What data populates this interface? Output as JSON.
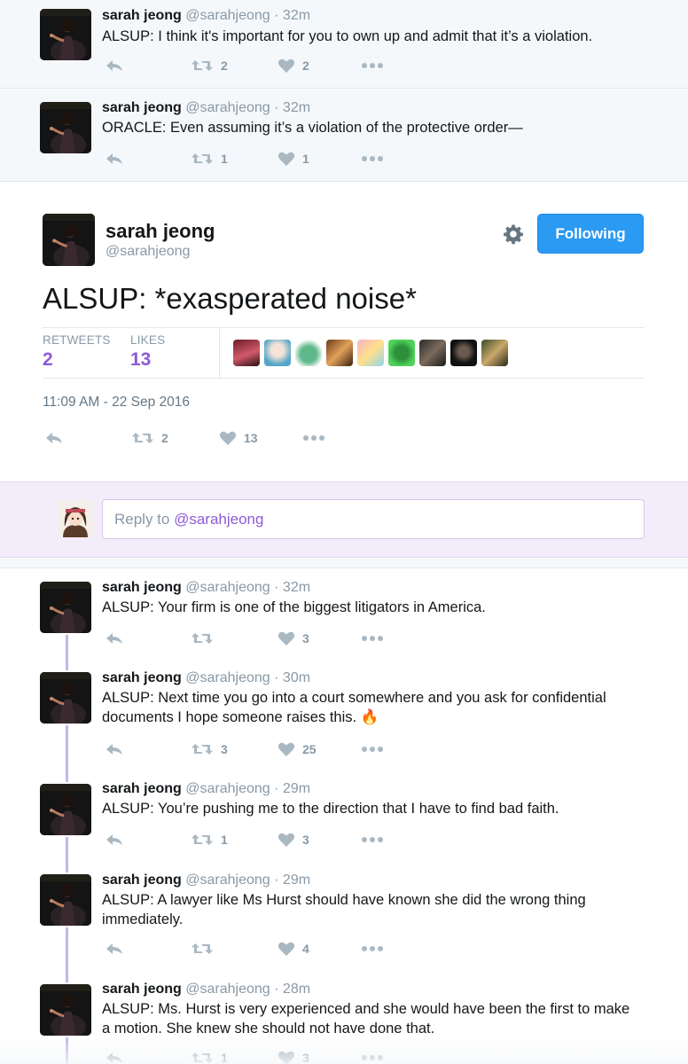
{
  "context_tweets": [
    {
      "name": "sarah jeong",
      "handle": "@sarahjeong",
      "time": "32m",
      "text": "ALSUP: I think it's important for you to own up and admit that it’s a violation.",
      "retweets": "2",
      "likes": "2"
    },
    {
      "name": "sarah jeong",
      "handle": "@sarahjeong",
      "time": "32m",
      "text": "ORACLE: Even assuming it’s a violation of the protective order—",
      "retweets": "1",
      "likes": "1"
    }
  ],
  "main_tweet": {
    "name": "sarah jeong",
    "handle": "@sarahjeong",
    "follow_label": "Following",
    "text": "ALSUP: *exasperated noise*",
    "retweets_label": "RETWEETS",
    "retweets": "2",
    "likes_label": "LIKES",
    "likes": "13",
    "date": "11:09 AM - 22 Sep 2016",
    "action_retweets": "2",
    "action_likes": "13"
  },
  "reply": {
    "prefix": "Reply to ",
    "mention": "@sarahjeong"
  },
  "replies": [
    {
      "name": "sarah jeong",
      "handle": "@sarahjeong",
      "time": "32m",
      "text": "ALSUP: Your firm is one of the biggest litigators in America.",
      "retweets": "",
      "likes": "3"
    },
    {
      "name": "sarah jeong",
      "handle": "@sarahjeong",
      "time": "30m",
      "text": "ALSUP: Next time you go into a court somewhere and you ask for confidential documents I hope someone raises this. 🔥",
      "retweets": "3",
      "likes": "25"
    },
    {
      "name": "sarah jeong",
      "handle": "@sarahjeong",
      "time": "29m",
      "text": "ALSUP: You’re pushing me to the direction that I have to find bad faith.",
      "retweets": "1",
      "likes": "3"
    },
    {
      "name": "sarah jeong",
      "handle": "@sarahjeong",
      "time": "29m",
      "text": "ALSUP: A lawyer like Ms Hurst should have known she did the wrong thing immediately.",
      "retweets": "",
      "likes": "4"
    },
    {
      "name": "sarah jeong",
      "handle": "@sarahjeong",
      "time": "28m",
      "text": "ALSUP: Ms. Hurst is very experienced and she would have been the first to make a motion. She knew she should not have done that.",
      "retweets": "1",
      "likes": "3"
    }
  ],
  "colors": {
    "accent": "#8d5ad8",
    "follow_button": "#2b9af3",
    "thread_line": "#c6b5ec",
    "meta_gray": "#8899a6"
  }
}
